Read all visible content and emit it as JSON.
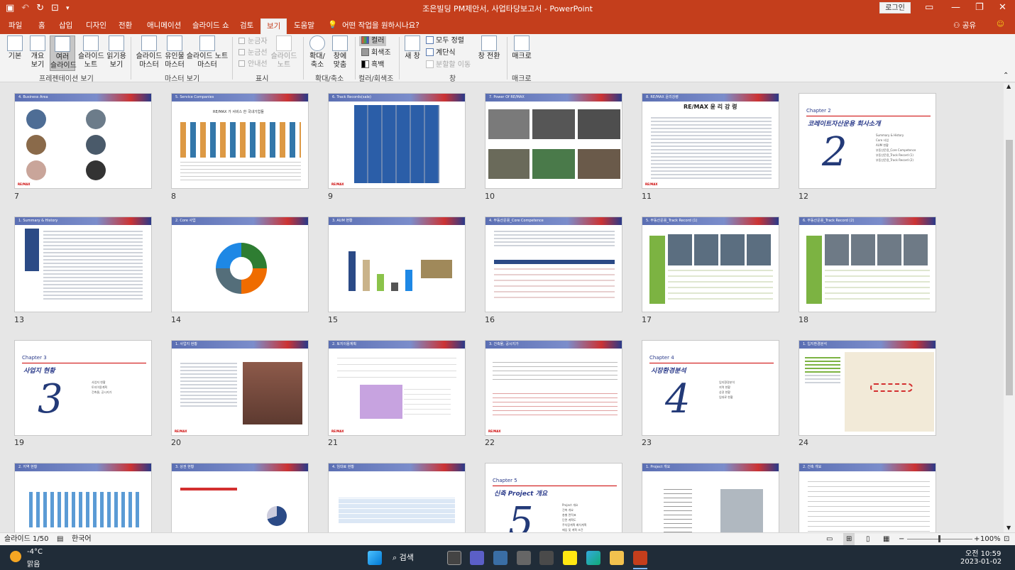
{
  "window": {
    "title": "조은빌딩 PM제안서, 사업타당보고서  -  PowerPoint",
    "login_label": "로그인",
    "share_label": "공유"
  },
  "tabs": [
    {
      "label": "파일"
    },
    {
      "label": "홈"
    },
    {
      "label": "삽입"
    },
    {
      "label": "디자인"
    },
    {
      "label": "전환"
    },
    {
      "label": "애니메이션"
    },
    {
      "label": "슬라이드 쇼"
    },
    {
      "label": "검토"
    },
    {
      "label": "보기"
    },
    {
      "label": "도움말"
    }
  ],
  "tell_me": "어떤 작업을 원하시나요?",
  "ribbon": {
    "btn_normal": "기본",
    "btn_outline": "개요\n보기",
    "btn_sorter": "여러\n슬라이드",
    "btn_notes": "슬라이드\n노트",
    "btn_reading": "읽기용\n보기",
    "btn_slide_master": "슬라이드\n마스터",
    "btn_handout_master": "유인물\n마스터",
    "btn_notes_master": "슬라이드 노트\n마스터",
    "chk_ruler": "눈금자",
    "chk_grid": "눈금선",
    "chk_guides": "안내선",
    "btn_notes_show": "슬라이드\n노트",
    "btn_zoom": "확대/\n축소",
    "btn_fit": "창에\n맞춤",
    "color_color": "컬러",
    "color_gray": "회색조",
    "color_bw": "흑백",
    "btn_new_window": "새 창",
    "arrange_all": "모두 정렬",
    "cascade": "계단식",
    "move_split": "분할할 이동",
    "btn_switch": "창 전환",
    "btn_macro": "매크로",
    "grp_presentation": "프레젠테이션 보기",
    "grp_master": "마스터 보기",
    "grp_show": "표시",
    "grp_zoom": "확대/축소",
    "grp_color": "컬러/회색조",
    "grp_window": "창",
    "grp_macro": "매크로"
  },
  "slides": [
    {
      "num": "7",
      "title": "4. Business Area"
    },
    {
      "num": "8",
      "title": "5. Service Companies",
      "subtitle": "RE/MAX 가 서비스 한 국내기업들"
    },
    {
      "num": "9",
      "title": "6. Track Records(sale)"
    },
    {
      "num": "10",
      "title": "7. Power Of RE/MAX"
    },
    {
      "num": "11",
      "title": "8. RE/MAX 윤리강령",
      "heading": "RE/MAX 윤 리 강 령"
    },
    {
      "num": "12",
      "chapter": "Chapter 2",
      "chapter_title": "코레이트자산운용 회사소개",
      "big": "2",
      "list": [
        "Summary & History",
        "Core 사업",
        "AUM 현황",
        "부동산운용_Core Competence",
        "부동산운용_Track Record (1)",
        "부동산운용_Track Record (2)"
      ]
    },
    {
      "num": "13",
      "title": "1. Summary & History"
    },
    {
      "num": "14",
      "title": "2. Core 사업"
    },
    {
      "num": "15",
      "title": "3. AUM 현황"
    },
    {
      "num": "16",
      "title": "4. 부동산운용_Core Competence"
    },
    {
      "num": "17",
      "title": "5. 부동산운용_Track Record (1)"
    },
    {
      "num": "18",
      "title": "6. 부동산운용_Track Record (2)"
    },
    {
      "num": "19",
      "chapter": "Chapter 3",
      "chapter_title": "사업지 현황",
      "big": "3",
      "list": [
        "사업지 현황",
        "토지이용계획",
        "건축물, 공시지가"
      ]
    },
    {
      "num": "20",
      "title": "1. 사업지 현황"
    },
    {
      "num": "21",
      "title": "2. 토지이용계획"
    },
    {
      "num": "22",
      "title": "3. 건축물, 공시지가"
    },
    {
      "num": "23",
      "chapter": "Chapter 4",
      "chapter_title": "시장환경분석",
      "big": "4",
      "list": [
        "입지환경분석",
        "지역 현황",
        "상권 현황",
        "임대료 현황"
      ]
    },
    {
      "num": "24",
      "title": "1. 입지환경분석"
    },
    {
      "num": "25",
      "title": "2. 지역 현황"
    },
    {
      "num": "26",
      "title": "3. 상권 현황"
    },
    {
      "num": "27",
      "title": "4. 임대료 현황"
    },
    {
      "num": "28",
      "chapter": "Chapter 5",
      "chapter_title": "신축 Project 개요",
      "big": "5",
      "list": [
        "Project 개요",
        "건축 개요",
        "층별 면적표",
        "단면 계획도",
        "주차장계획 배치계획",
        "매입 및 계획 조건"
      ]
    },
    {
      "num": "29",
      "title": "1. Project 개요"
    },
    {
      "num": "30",
      "title": "2. 건축 개요"
    }
  ],
  "status": {
    "slide_info": "슬라이드 1/50",
    "language": "한국어",
    "zoom": "100%"
  },
  "taskbar": {
    "weather_temp": "-4°C",
    "weather_desc": "맑음",
    "search": "검색",
    "time": "오전 10:59",
    "date": "2023-01-02"
  }
}
